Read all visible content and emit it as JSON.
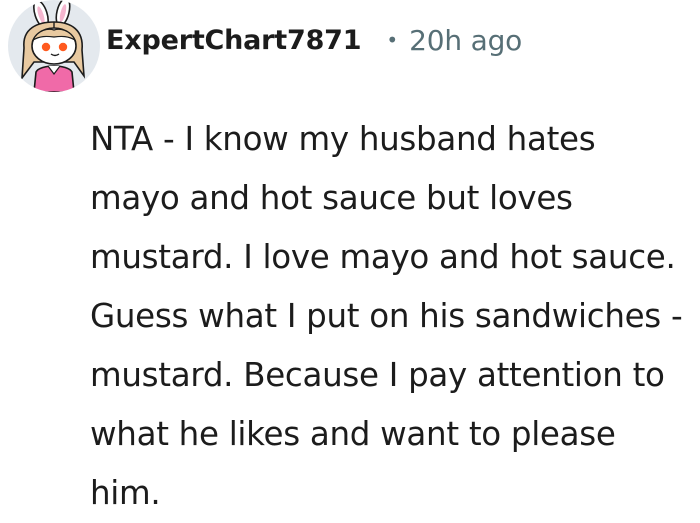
{
  "comment": {
    "avatar_icon": "snoo-bunny-avatar-icon",
    "author": "ExpertChart7871",
    "separator": "•",
    "timestamp": "20h ago",
    "body": "NTA - I know my husband hates mayo and hot sauce but loves mustard. I love mayo and hot sauce. Guess what I put on his sandwiches - mustard. Because I pay attention to what he likes and want to please him."
  },
  "colors": {
    "text": "#1c1c1c",
    "meta": "#576f76",
    "avatar_bg": "#e4e9ee",
    "avatar_shirt": "#f06aa8"
  }
}
